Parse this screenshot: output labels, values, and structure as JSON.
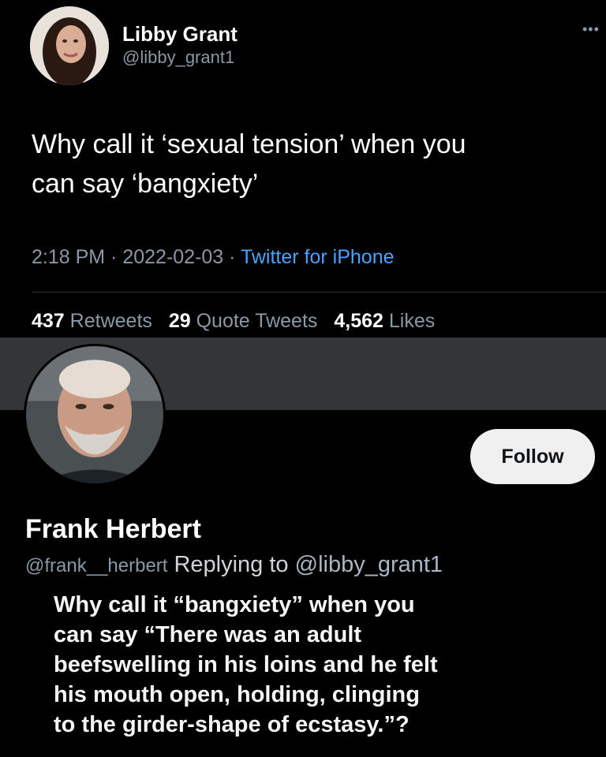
{
  "tweet": {
    "author_name": "Libby Grant",
    "author_handle": "@libby_grant1",
    "more_icon": "more-horizontal-icon",
    "text_line1": "Why call it ‘sexual tension’ when you",
    "text_line2": "can say ‘bangxiety’",
    "time": "2:18 PM",
    "sep": " · ",
    "date": "2022-02-03",
    "source": "Twitter for iPhone",
    "stats": {
      "retweets_count": "437",
      "retweets_label": "Retweets",
      "quotes_count": "29",
      "quotes_label": "Quote Tweets",
      "likes_count": "4,562",
      "likes_label": "Likes"
    }
  },
  "reply": {
    "author_name": "Frank Herbert",
    "author_handle": "@frank__herbert",
    "replying_label": "Replying to",
    "replying_mention": "@libby_grant1",
    "follow_label": "Follow",
    "text_lines": [
      "Why call it “bangxiety” when you",
      "can say “There was an adult",
      "beefswelling in his loins and he felt",
      "his mouth open, holding, clinging",
      "to the girder-shape of ecstasy.”?"
    ]
  },
  "colors": {
    "background": "#000000",
    "secondary_text": "#8b98a5",
    "link": "#4aa3ff",
    "band": "#333537",
    "follow_button": "#f0f0f0"
  }
}
